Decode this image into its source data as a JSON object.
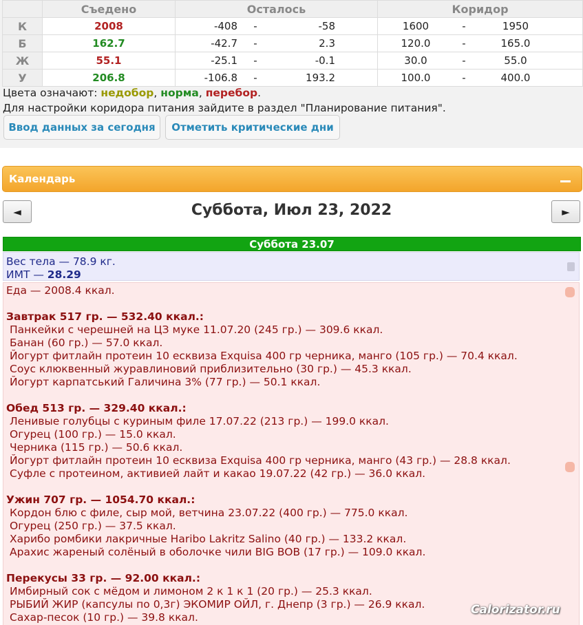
{
  "colors": {
    "under": "#999900",
    "norm": "#228b22",
    "over": "#b22222",
    "link": "#2a8ab9",
    "calendar_bar": "#f3a52b",
    "day_header": "#12a412",
    "food_text": "#8c1010",
    "weight_text": "#1f2a8a"
  },
  "summary": {
    "headers": {
      "eaten": "Съедено",
      "left": "Осталось",
      "corridor": "Коридор"
    },
    "rows": [
      {
        "nutr": "К",
        "eaten": "2008",
        "eaten_status": "over",
        "left_min": "-408",
        "left_dash": "-",
        "left_max": "-58",
        "cor_min": "1600",
        "cor_dash": "-",
        "cor_max": "1950"
      },
      {
        "nutr": "Б",
        "eaten": "162.7",
        "eaten_status": "norm",
        "left_min": "-42.7",
        "left_dash": "-",
        "left_max": "2.3",
        "cor_min": "120.0",
        "cor_dash": "-",
        "cor_max": "165.0"
      },
      {
        "nutr": "Ж",
        "eaten": "55.1",
        "eaten_status": "over",
        "left_min": "-25.1",
        "left_dash": "-",
        "left_max": "-0.1",
        "cor_min": "30.0",
        "cor_dash": "-",
        "cor_max": "55.0"
      },
      {
        "nutr": "У",
        "eaten": "206.8",
        "eaten_status": "norm",
        "left_min": "-106.8",
        "left_dash": "-",
        "left_max": "193.2",
        "cor_min": "100.0",
        "cor_dash": "-",
        "cor_max": "400.0"
      }
    ]
  },
  "legend": {
    "prefix": "Цвета означают: ",
    "under": "недобор",
    "sep1": ", ",
    "norm": "норма",
    "sep2": ", ",
    "over": "перебор",
    "suffix": "."
  },
  "hint": "Для настройки коридора питания зайдите в раздел \"Планирование питания\".",
  "buttons": {
    "enter_today": "Ввод данных за сегодня",
    "critical_days": "Отметить критические дни"
  },
  "calendar": {
    "title": "Календарь",
    "prev": "◄",
    "next": "►",
    "date_title": "Суббота, Июл 23, 2022",
    "day_header": "Суббота 23.07"
  },
  "weight": {
    "body_weight": "Вес тела — 78.9 кг.",
    "bmi_label": "ИМТ — ",
    "bmi_value": "28.29"
  },
  "food": {
    "total": "Еда — 2008.4 ккал.",
    "meals": [
      {
        "title": "Завтрак 517 гр. — 532.40 ккал.:",
        "items": [
          "Панкейки с черешней на ЦЗ муке 11.07.20 (245 гр.) — 309.6 ккал.",
          "Банан (60 гр.) — 57.0 ккал.",
          "Йогурт фитлайн протеин 10 есквиза Exquisa 400 гр черника, манго (105 гр.) — 70.4 ккал.",
          "Соус клюквенный журавлиновий приблизительно (30 гр.) — 45.3 ккал.",
          "Йогурт карпатський Галичина 3% (77 гр.) — 50.1 ккал."
        ]
      },
      {
        "title": "Обед 513 гр. — 329.40 ккал.:",
        "items": [
          "Ленивые голубцы с куриным филе 17.07.22 (213 гр.) — 199.0 ккал.",
          "Огурец (100 гр.) — 15.0 ккал.",
          "Черника (115 гр.) — 50.6 ккал.",
          "Йогурт фитлайн протеин 10 есквиза Exquisa 400 гр черника, манго (43 гр.) — 28.8 ккал.",
          "Суфле с протеином, активией лайт и какао 19.07.22 (42 гр.) — 36.0 ккал."
        ]
      },
      {
        "title": "Ужин 707 гр. — 1054.70 ккал.:",
        "items": [
          "Кордон блю с филе, сыр мой, ветчина 23.07.22 (400 гр.) — 775.0 ккал.",
          "Огурец (250 гр.) — 37.5 ккал.",
          "Харибо ромбики лакричные Haribo Lakritz Salino (40 гр.) — 133.2 ккал.",
          "Арахис жареный солёный в оболочке чили BIG BOB (17 гр.) — 109.0 ккал."
        ]
      },
      {
        "title": "Перекусы 33 гр. — 92.00 ккал.:",
        "items": [
          "Имбирный сок с мёдом и лимоном 2 к 1 к 1 (20 гр.) — 25.3 ккал.",
          "РЫБИЙ ЖИР (капсулы по 0,3г) ЭКОМИР ОЙЛ, г. Днепр (3 гр.) — 26.9 ккал.",
          "Сахар-песок (10 гр.) — 39.8 ккал."
        ]
      }
    ]
  },
  "watermark": "Calorizator.ru"
}
